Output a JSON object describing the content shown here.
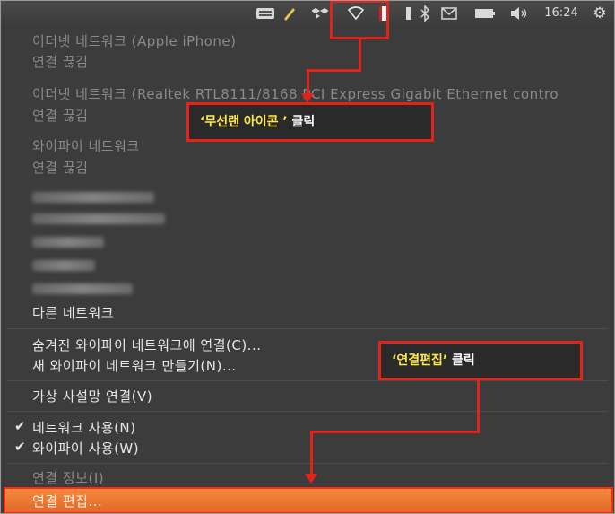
{
  "panel": {
    "clock": "16:24",
    "icons": [
      "keyboard-icon",
      "dropbox-icon",
      "wifi-icon",
      "battery-card-icon",
      "bluetooth-icon",
      "mail-icon",
      "battery-icon",
      "volume-icon",
      "gear-icon"
    ]
  },
  "menu": {
    "eth1_title": "이더넷 네트워크 (Apple iPhone)",
    "eth1_status": "연결 끊김",
    "eth2_title": "이더넷 네트워크 (Realtek RTL8111/8168 PCI Express Gigabit Ethernet contro",
    "eth2_status": "연결 끊김",
    "wifi_title": "와이파이 네트워크",
    "wifi_status": "연결 끊김",
    "other_networks": "다른 네트워크",
    "connect_hidden": "숨겨진 와이파이 네트워크에 연결(C)...",
    "create_new": "새 와이파이 네트워크 만들기(N)...",
    "vpn": "가상 사설망 연결(V)",
    "enable_networking": "네트워크 사용(N)",
    "enable_wifi": "와이파이 사용(W)",
    "check_mark": "✔",
    "connection_info": "연결 정보(I)",
    "edit_connections": "연결 편집..."
  },
  "callouts": {
    "wireless_icon_quote": "‘무선랜 아이콘 ’",
    "wireless_icon_action": " 클릭",
    "edit_connections_quote": "‘연결편집’",
    "edit_connections_action": " 클릭"
  },
  "colors": {
    "highlight": "#f0782f",
    "annotation_red": "#e0241b",
    "annotation_yellow": "#ffe94a"
  }
}
